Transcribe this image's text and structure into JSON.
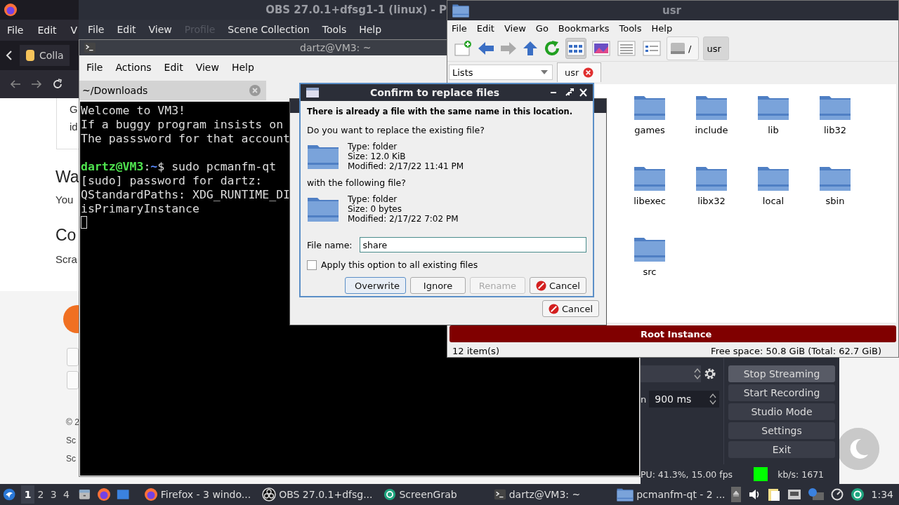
{
  "firefox": {
    "menu": [
      "File",
      "Edit",
      "V"
    ],
    "tab_title": "Colla",
    "content": {
      "card_lines": [
        "G",
        "id"
      ],
      "heading_1": "Wa",
      "text_1": "You",
      "heading_2": "Co",
      "text_2": "Scra",
      "footer_lines": [
        "© 2",
        "Sc",
        "Sc"
      ]
    }
  },
  "obs": {
    "title": "OBS 27.0.1+dfsg1-1 (linux) - P",
    "menu": [
      {
        "label": "File",
        "disabled": false
      },
      {
        "label": "Edit",
        "disabled": false
      },
      {
        "label": "View",
        "disabled": false
      },
      {
        "label": "Profile",
        "disabled": true
      },
      {
        "label": "Scene Collection",
        "disabled": false
      },
      {
        "label": "Tools",
        "disabled": false
      },
      {
        "label": "Help",
        "disabled": false
      }
    ],
    "delay_label": "n",
    "delay_value": "900 ms",
    "controls": [
      {
        "label": "Stop Streaming",
        "active": true
      },
      {
        "label": "Start Recording",
        "active": false
      },
      {
        "label": "Studio Mode",
        "active": false
      },
      {
        "label": "Settings",
        "active": false
      },
      {
        "label": "Exit",
        "active": false
      }
    ],
    "status": {
      "cpu": "PU: 41.3%, 15.00 fps",
      "bitrate": "kb/s: 1671"
    }
  },
  "terminal": {
    "title": "dartz@VM3: ~",
    "menu": [
      "File",
      "Actions",
      "Edit",
      "View",
      "Help"
    ],
    "tab": "~/Downloads",
    "lines": [
      {
        "kind": "text",
        "text": "Welcome to VM3!"
      },
      {
        "kind": "text",
        "text": "If a buggy program insists on"
      },
      {
        "kind": "text",
        "text": "The passsword for that account"
      },
      {
        "kind": "blank"
      },
      {
        "kind": "prompt",
        "user_host": "dartz@VM3",
        "separator": ":",
        "path": "~",
        "command": "$ sudo pcmanfm-qt"
      },
      {
        "kind": "text",
        "text": "[sudo] password for dartz:"
      },
      {
        "kind": "text",
        "text": "QStandardPaths: XDG_RUNTIME_DI"
      },
      {
        "kind": "text",
        "text": "isPrimaryInstance"
      },
      {
        "kind": "cursor"
      }
    ]
  },
  "file_manager": {
    "title": "usr",
    "menu": [
      "File",
      "Edit",
      "View",
      "Go",
      "Bookmarks",
      "Tools",
      "Help"
    ],
    "view_modes": [
      {
        "selected": true
      },
      {
        "selected": false
      },
      {
        "selected": false
      },
      {
        "selected": false
      }
    ],
    "path_buttons": [
      {
        "label": "/",
        "selected": false
      },
      {
        "label": "usr",
        "selected": true
      }
    ],
    "side_pane": "Lists",
    "tabs": [
      {
        "label": "usr",
        "selected": true
      }
    ],
    "items": [
      "games",
      "include",
      "lib",
      "lib32",
      "libexec",
      "libx32",
      "local",
      "sbin",
      "src"
    ],
    "instance_banner": "Root Instance",
    "status": {
      "count": "12 item(s)",
      "free_space": "Free space: 50.8 GiB (Total: 62.7 GiB)"
    }
  },
  "back_dialog": {
    "cancel": "Cancel"
  },
  "confirm_dialog": {
    "title": "Confirm to replace files",
    "message": "There is already a file with the same name in this location.",
    "question": "Do you want to replace the existing file?",
    "existing": {
      "type": "Type: folder",
      "size": "Size: 12.0 KiB",
      "modified": "Modified: 2/17/22 11:41 PM"
    },
    "with_label": "with the following file?",
    "new": {
      "type": "Type: folder",
      "size": "Size: 0 bytes",
      "modified": "Modified: 2/17/22 7:02 PM"
    },
    "file_name_label": "File name:",
    "file_name": "share",
    "apply_all": {
      "label": "Apply this option to all existing files",
      "checked": false
    },
    "buttons": [
      {
        "kind": "overwrite",
        "label": "Overwrite",
        "disabled": false,
        "default": true
      },
      {
        "kind": "plain",
        "label": "Ignore",
        "disabled": false,
        "default": false
      },
      {
        "kind": "plain",
        "label": "Rename",
        "disabled": true,
        "default": false
      },
      {
        "kind": "cancel",
        "label": "Cancel",
        "disabled": false,
        "default": false
      }
    ]
  },
  "taskbar": {
    "workspaces": [
      {
        "label": "1",
        "selected": true
      },
      {
        "label": "2",
        "selected": false
      },
      {
        "label": "3",
        "selected": false
      },
      {
        "label": "4",
        "selected": false
      }
    ],
    "tasks": [
      {
        "kind": "firefox",
        "label": "Firefox - 3 windo..."
      },
      {
        "kind": "obs",
        "label": "OBS 27.0.1+dfsg..."
      },
      {
        "kind": "screengrab",
        "label": "ScreenGrab"
      },
      {
        "kind": "terminal",
        "label": "dartz@VM3: ~"
      },
      {
        "kind": "folder",
        "label": "pcmanfm-qt - 2 ..."
      }
    ],
    "clock": "1:34"
  }
}
